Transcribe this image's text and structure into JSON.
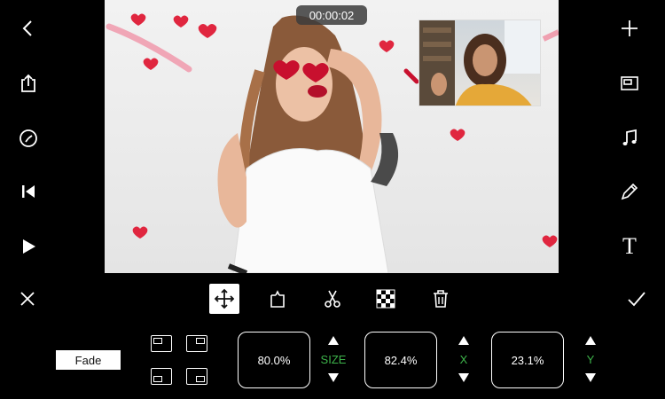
{
  "preview": {
    "timer": "00:00:02"
  },
  "left_sidebar": {
    "icons": [
      "chevron-left-icon",
      "share-icon",
      "clock-icon",
      "skip-back-icon",
      "play-icon"
    ]
  },
  "right_sidebar": {
    "icons": [
      "plus-icon",
      "overlay-icon",
      "music-icon",
      "pencil-icon",
      "text-icon"
    ],
    "text_glyph": "T"
  },
  "toolbar": {
    "tools": [
      "move-icon",
      "rotate-icon",
      "cut-icon",
      "checker-icon",
      "trash-icon"
    ]
  },
  "controls": {
    "fade_label": "Fade",
    "size_value": "80.0%",
    "size_label": "SIZE",
    "x_value": "82.4%",
    "x_label": "X",
    "y_value": "23.1%",
    "y_label": "Y",
    "label_color": "#3db34a"
  }
}
